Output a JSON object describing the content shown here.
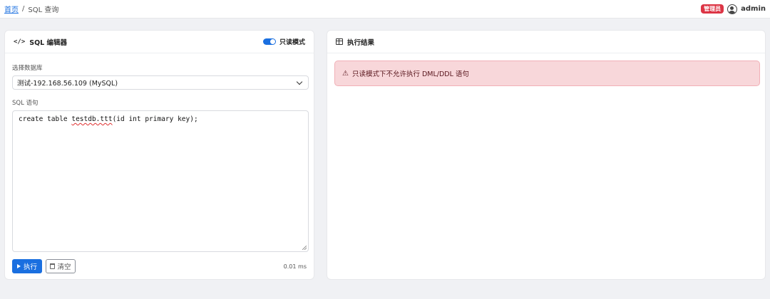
{
  "breadcrumb": {
    "home": "首页",
    "separator": "/",
    "current": "SQL 查询"
  },
  "user": {
    "role_badge": "管理员",
    "username": "admin"
  },
  "editor_card": {
    "title": "SQL 编辑器",
    "title_icon": "code-icon",
    "readonly_label": "只读模式",
    "readonly_enabled": true,
    "db_label": "选择数据库",
    "db_selected": "测试-192.168.56.109 (MySQL)",
    "sql_label": "SQL 语句",
    "sql_before": "create table ",
    "sql_flagged": "testdb.ttt",
    "sql_after": "(id int primary key);",
    "run_label": "执行",
    "clear_label": "清空",
    "exec_time": "0.01 ms"
  },
  "result_card": {
    "title": "执行结果",
    "title_icon": "table-icon",
    "alert_message": "只读模式下不允许执行 DML/DDL 语句"
  },
  "colors": {
    "primary": "#1a6fe0",
    "danger": "#dc3545",
    "alert_bg": "#f8d7da",
    "page_bg": "#f0f1f4"
  }
}
